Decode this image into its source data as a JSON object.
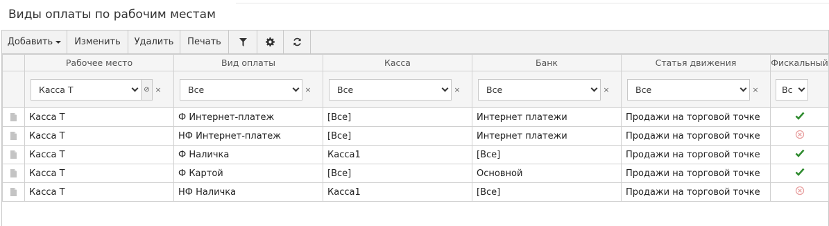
{
  "page": {
    "title": "Виды оплаты по рабочим местам"
  },
  "toolbar": {
    "add_label": "Добавить",
    "edit_label": "Изменить",
    "delete_label": "Удалить",
    "print_label": "Печать",
    "icons": [
      "filter-icon",
      "gear-icon",
      "refresh-icon"
    ]
  },
  "columns": [
    "Рабочее место",
    "Вид оплаты",
    "Касса",
    "Банк",
    "Статья движения",
    "Фискальный"
  ],
  "filters": {
    "workplace": "Касса Т",
    "payment_type": "Все",
    "cashbox": "Все",
    "bank": "Все",
    "movement": "Все",
    "fiscal": "Вс",
    "clear_symbol": "×",
    "extra_symbol": "⊘"
  },
  "rows": [
    {
      "workplace": "Касса Т",
      "payment_type": "Ф Интернет-платеж",
      "cashbox": "[Все]",
      "bank": "Интернет платежи",
      "movement": "Продажи на торговой точке",
      "fiscal": true
    },
    {
      "workplace": "Касса Т",
      "payment_type": "НФ Интернет-платеж",
      "cashbox": "[Все]",
      "bank": "Интернет платежи",
      "movement": "Продажи на торговой точке",
      "fiscal": false
    },
    {
      "workplace": "Касса Т",
      "payment_type": "Ф Наличка",
      "cashbox": "Касса1",
      "bank": "[Все]",
      "movement": "Продажи на торговой точке",
      "fiscal": true
    },
    {
      "workplace": "Касса Т",
      "payment_type": "Ф Картой",
      "cashbox": "[Все]",
      "bank": "Основной",
      "movement": "Продажи на торговой точке",
      "fiscal": true
    },
    {
      "workplace": "Касса Т",
      "payment_type": "НФ Наличка",
      "cashbox": "Касса1",
      "bank": "[Все]",
      "movement": "Продажи на торговой точке",
      "fiscal": false
    }
  ],
  "colors": {
    "check": "#2e8b2e",
    "cross": "#e8a0a0"
  }
}
